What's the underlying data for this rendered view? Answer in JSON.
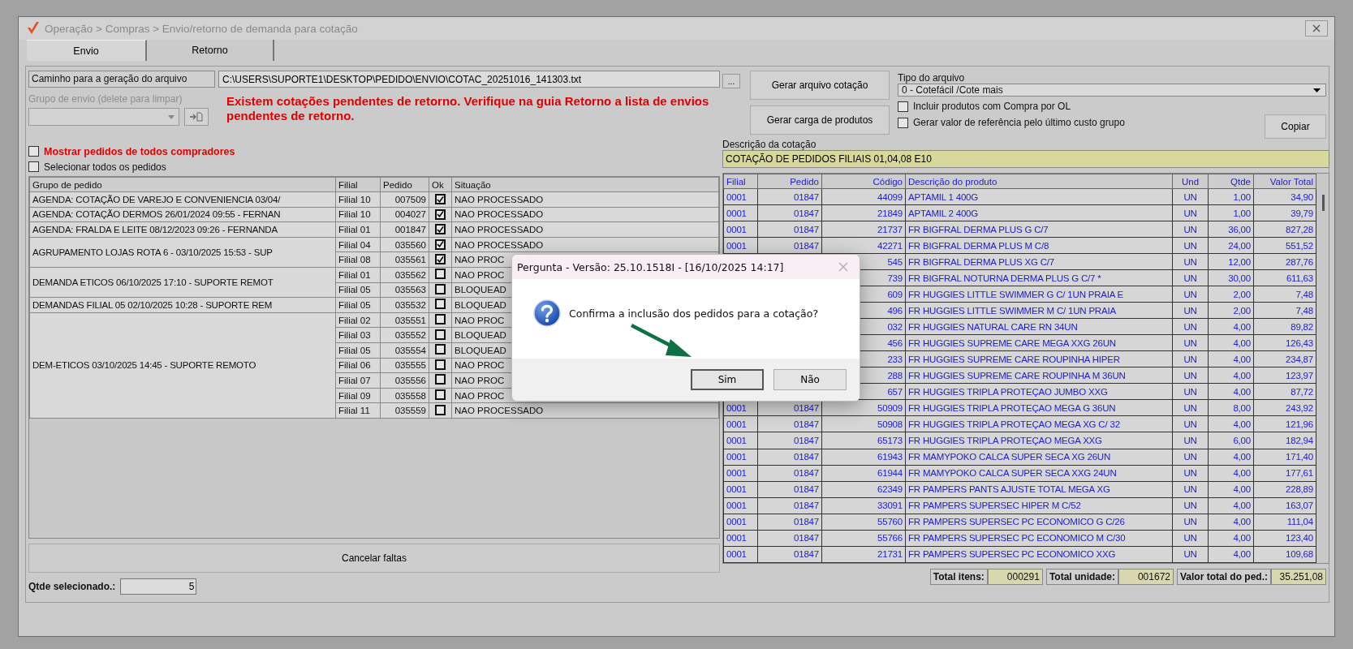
{
  "window": {
    "title": "Operação > Compras > Envio/retorno de demanda para cotação"
  },
  "tabs": [
    {
      "label": "Envio",
      "selected": true
    },
    {
      "label": "Retorno",
      "selected": false
    }
  ],
  "file_path": {
    "label": "Caminho para a geração do arquivo",
    "value": "C:\\USERS\\SUPORTE1\\DESKTOP\\PEDIDO\\ENVIO\\COTAC_20251016_141303.txt",
    "browse_button": "..."
  },
  "send_group": {
    "label": "Grupo de envio (delete para limpar)",
    "disabled": true
  },
  "warning": "Existem cotações pendentes de retorno. Verifique na guia Retorno a lista de envios pendentes de retorno.",
  "options": [
    {
      "label": "Mostrar pedidos de todos compradores",
      "checked": false,
      "kind": "alert"
    },
    {
      "label": "Selecionar todos os pedidos",
      "checked": false,
      "kind": "plain"
    }
  ],
  "orders_table": {
    "columns": [
      "Grupo de pedido",
      "Filial",
      "Pedido",
      "Ok",
      "Situação"
    ],
    "groups": [
      {
        "name": "AGENDA: COTAÇÃO DE VAREJO E CONVENIENCIA 03/04/",
        "orders": [
          {
            "filial": "Filial 10",
            "pedido": "007509",
            "ok": true,
            "situacao": "NAO PROCESSADO"
          }
        ]
      },
      {
        "name": "AGENDA: COTAÇÃO DERMOS 26/01/2024 09:55 - FERNAN",
        "orders": [
          {
            "filial": "Filial 10",
            "pedido": "004027",
            "ok": true,
            "situacao": "NAO PROCESSADO"
          }
        ]
      },
      {
        "name": "AGENDA: FRALDA E LEITE 08/12/2023 09:26 - FERNANDA",
        "orders": [
          {
            "filial": "Filial 01",
            "pedido": "001847",
            "ok": true,
            "situacao": "NAO PROCESSADO"
          }
        ]
      },
      {
        "name": "AGRUPAMENTO LOJAS ROTA 6 - 03/10/2025 15:53 - SUP",
        "orders": [
          {
            "filial": "Filial 04",
            "pedido": "035560",
            "ok": true,
            "situacao": "NAO PROCESSADO"
          },
          {
            "filial": "Filial 08",
            "pedido": "035561",
            "ok": true,
            "situacao": "NAO PROC"
          }
        ]
      },
      {
        "name": "DEMANDA ETICOS 06/10/2025 17:10 - SUPORTE REMOT",
        "orders": [
          {
            "filial": "Filial 01",
            "pedido": "035562",
            "ok": false,
            "situacao": "NAO PROC"
          },
          {
            "filial": "Filial 05",
            "pedido": "035563",
            "ok": false,
            "situacao": "BLOQUEAD"
          }
        ]
      },
      {
        "name": "DEMANDAS FILIAL 05 02/10/2025 10:28 - SUPORTE REM",
        "orders": [
          {
            "filial": "Filial 05",
            "pedido": "035532",
            "ok": false,
            "situacao": "BLOQUEAD"
          }
        ]
      },
      {
        "name": "DEM-ETICOS 03/10/2025 14:45 - SUPORTE REMOTO",
        "orders": [
          {
            "filial": "Filial 02",
            "pedido": "035551",
            "ok": false,
            "situacao": "NAO PROC"
          },
          {
            "filial": "Filial 03",
            "pedido": "035552",
            "ok": false,
            "situacao": "BLOQUEAD"
          },
          {
            "filial": "Filial 05",
            "pedido": "035554",
            "ok": false,
            "situacao": "BLOQUEAD"
          },
          {
            "filial": "Filial 06",
            "pedido": "035555",
            "ok": false,
            "situacao": "NAO PROC"
          },
          {
            "filial": "Filial 07",
            "pedido": "035556",
            "ok": false,
            "situacao": "NAO PROC"
          },
          {
            "filial": "Filial 09",
            "pedido": "035558",
            "ok": false,
            "situacao": "NAO PROC"
          },
          {
            "filial": "Filial 11",
            "pedido": "035559",
            "ok": false,
            "situacao": "NAO PROCESSADO"
          }
        ]
      }
    ]
  },
  "cancel_button": "Cancelar faltas",
  "selected_count": {
    "label": "Qtde selecionado.:",
    "value": "5"
  },
  "actions": [
    "Gerar arquivo cotação",
    "Gerar carga de produtos"
  ],
  "file_type": {
    "label": "Tipo do arquivo",
    "value": "0 - Cotefácil /Cote mais"
  },
  "file_options": [
    {
      "label": "Incluir produtos com Compra por OL",
      "checked": false
    },
    {
      "label": "Gerar valor de referência pelo último custo grupo",
      "checked": false
    }
  ],
  "copy_button": "Copiar",
  "description": {
    "label": "Descrição da cotação",
    "value": "COTAÇÃO DE PEDIDOS FILIAIS 01,04,08 E10"
  },
  "products_table": {
    "columns": [
      "Filial",
      "Pedido",
      "Código",
      "Descrição do produto",
      "Und",
      "Qtde",
      "Valor Total"
    ],
    "rows": [
      {
        "filial": "0001",
        "pedido": "01847",
        "codigo": "44099",
        "descricao": "APTAMIL 1 400G",
        "und": "UN",
        "qtde": "1,00",
        "valor_total": "34,90"
      },
      {
        "filial": "0001",
        "pedido": "01847",
        "codigo": "21849",
        "descricao": "APTAMIL 2 400G",
        "und": "UN",
        "qtde": "1,00",
        "valor_total": "39,79"
      },
      {
        "filial": "0001",
        "pedido": "01847",
        "codigo": "21737",
        "descricao": "FR BIGFRAL DERMA PLUS G C/7",
        "und": "UN",
        "qtde": "36,00",
        "valor_total": "827,28"
      },
      {
        "filial": "0001",
        "pedido": "01847",
        "codigo": "42271",
        "descricao": "FR BIGFRAL DERMA PLUS M C/8",
        "und": "UN",
        "qtde": "24,00",
        "valor_total": "551,52"
      },
      {
        "codigo": "545",
        "descricao": "FR BIGFRAL DERMA PLUS XG C/7",
        "und": "UN",
        "qtde": "12,00",
        "valor_total": "287,76"
      },
      {
        "codigo": "739",
        "descricao": "FR BIGFRAL NOTURNA DERMA PLUS G C/7 *",
        "und": "UN",
        "qtde": "30,00",
        "valor_total": "611,63"
      },
      {
        "codigo": "609",
        "descricao": "FR HUGGIES LITTLE SWIMMER G C/ 1UN PRAIA E",
        "und": "UN",
        "qtde": "2,00",
        "valor_total": "7,48"
      },
      {
        "codigo": "496",
        "descricao": "FR HUGGIES LITTLE SWIMMER M C/ 1UN PRAIA",
        "und": "UN",
        "qtde": "2,00",
        "valor_total": "7,48"
      },
      {
        "codigo": "032",
        "descricao": "FR HUGGIES NATURAL CARE RN 34UN",
        "und": "UN",
        "qtde": "4,00",
        "valor_total": "89,82"
      },
      {
        "codigo": "456",
        "descricao": "FR HUGGIES SUPREME CARE MEGA XXG 26UN",
        "und": "UN",
        "qtde": "4,00",
        "valor_total": "126,43"
      },
      {
        "codigo": "233",
        "descricao": "FR HUGGIES SUPREME CARE ROUPINHA HIPER",
        "und": "UN",
        "qtde": "4,00",
        "valor_total": "234,87"
      },
      {
        "codigo": "288",
        "descricao": "FR HUGGIES SUPREME CARE ROUPINHA M 36UN",
        "und": "UN",
        "qtde": "4,00",
        "valor_total": "123,97"
      },
      {
        "codigo": "657",
        "descricao": "FR HUGGIES TRIPLA PROTEÇAO JUMBO XXG",
        "und": "UN",
        "qtde": "4,00",
        "valor_total": "87,72"
      },
      {
        "filial": "0001",
        "pedido": "01847",
        "codigo": "50909",
        "descricao": "FR HUGGIES TRIPLA PROTEÇAO MEGA G 36UN",
        "und": "UN",
        "qtde": "8,00",
        "valor_total": "243,92"
      },
      {
        "filial": "0001",
        "pedido": "01847",
        "codigo": "50908",
        "descricao": "FR HUGGIES TRIPLA PROTEÇAO MEGA XG C/ 32",
        "und": "UN",
        "qtde": "4,00",
        "valor_total": "121,96"
      },
      {
        "filial": "0001",
        "pedido": "01847",
        "codigo": "65173",
        "descricao": "FR HUGGIES TRIPLA PROTEÇAO MEGA XXG",
        "und": "UN",
        "qtde": "6,00",
        "valor_total": "182,94"
      },
      {
        "filial": "0001",
        "pedido": "01847",
        "codigo": "61943",
        "descricao": "FR MAMYPOKO CALCA SUPER SECA XG 26UN",
        "und": "UN",
        "qtde": "4,00",
        "valor_total": "171,40"
      },
      {
        "filial": "0001",
        "pedido": "01847",
        "codigo": "61944",
        "descricao": "FR MAMYPOKO CALCA SUPER SECA XXG 24UN",
        "und": "UN",
        "qtde": "4,00",
        "valor_total": "177,61"
      },
      {
        "filial": "0001",
        "pedido": "01847",
        "codigo": "62349",
        "descricao": "FR PAMPERS PANTS AJUSTE TOTAL MEGA XG",
        "und": "UN",
        "qtde": "4,00",
        "valor_total": "228,89"
      },
      {
        "filial": "0001",
        "pedido": "01847",
        "codigo": "33091",
        "descricao": "FR PAMPERS SUPERSEC HIPER M C/52",
        "und": "UN",
        "qtde": "4,00",
        "valor_total": "163,07"
      },
      {
        "filial": "0001",
        "pedido": "01847",
        "codigo": "55760",
        "descricao": "FR PAMPERS SUPERSEC PC ECONOMICO G C/26",
        "und": "UN",
        "qtde": "4,00",
        "valor_total": "111,04"
      },
      {
        "filial": "0001",
        "pedido": "01847",
        "codigo": "55766",
        "descricao": "FR PAMPERS SUPERSEC PC ECONOMICO M C/30",
        "und": "UN",
        "qtde": "4,00",
        "valor_total": "123,40"
      },
      {
        "filial": "0001",
        "pedido": "01847",
        "codigo": "21731",
        "descricao": "FR PAMPERS SUPERSEC PC ECONOMICO XXG",
        "und": "UN",
        "qtde": "4,00",
        "valor_total": "109,68"
      }
    ]
  },
  "totals": [
    {
      "label": "Total itens:",
      "value": "000291"
    },
    {
      "label": "Total unidade:",
      "value": "001672"
    },
    {
      "label": "Valor total do ped.:",
      "value": "35.251,08"
    }
  ],
  "dialog": {
    "title": "Pergunta - Versão: 25.10.1518I - [16/10/2025 14:17]",
    "message": "Confirma a inclusão dos pedidos para a cotação?",
    "buttons": [
      {
        "label": "Sim",
        "selected": true
      },
      {
        "label": "Não",
        "selected": false
      }
    ]
  }
}
